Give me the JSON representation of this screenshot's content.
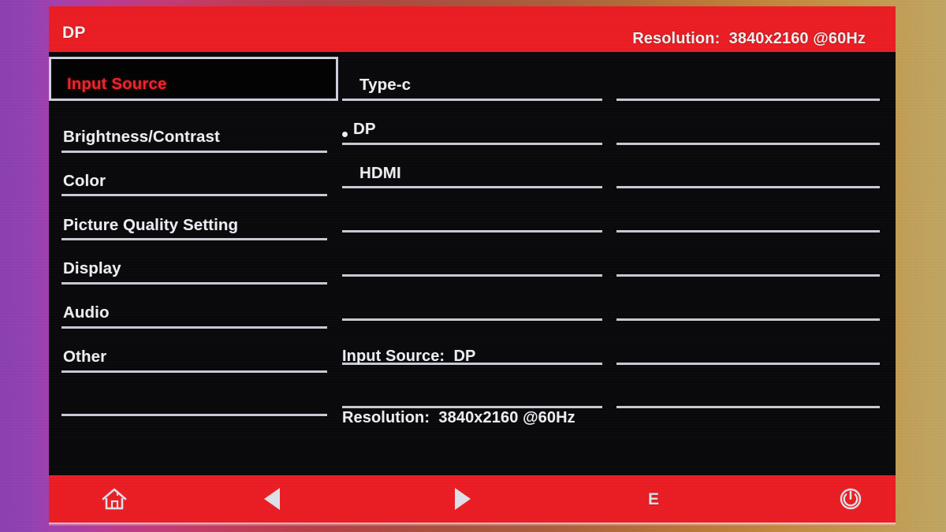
{
  "osd": {
    "titlebar": {
      "source_label": "DP",
      "resolution_label": "Resolution:",
      "resolution_value": "3840x2160 @60Hz",
      "resolution_full": "Resolution:  3840x2160 @60Hz"
    },
    "menu": {
      "items": [
        {
          "label": "Input Source",
          "selected": true
        },
        {
          "label": "Brightness/Contrast",
          "selected": false
        },
        {
          "label": "Color",
          "selected": false
        },
        {
          "label": "Picture Quality Setting",
          "selected": false
        },
        {
          "label": "Display",
          "selected": false
        },
        {
          "label": "Audio",
          "selected": false
        },
        {
          "label": "Other",
          "selected": false
        }
      ]
    },
    "options": {
      "items": [
        {
          "label": "Type-c",
          "active": false
        },
        {
          "label": "DP",
          "active": true
        },
        {
          "label": "HDMI",
          "active": false
        }
      ]
    },
    "status": {
      "input_source_label": "Input Source:",
      "input_source_value": "DP",
      "input_source_line": "Input Source:  DP",
      "resolution_label": "Resolution:",
      "resolution_value": "3840x2160 @60Hz",
      "resolution_line": "Resolution:  3840x2160 @60Hz"
    },
    "toolbar": {
      "buttons": [
        {
          "icon": "home-icon",
          "label": ""
        },
        {
          "icon": "triangle-left-icon",
          "label": ""
        },
        {
          "icon": "triangle-right-icon",
          "label": ""
        },
        {
          "icon": "text-icon",
          "label": "E"
        },
        {
          "icon": "power-icon",
          "label": ""
        }
      ],
      "exit_label": "E"
    },
    "colors": {
      "accent_red": "#ed1c22",
      "panel_black": "#070608",
      "rule_white": "#c9ccd6",
      "text_white": "#eef0f5",
      "selected_red": "#f0222a"
    }
  }
}
